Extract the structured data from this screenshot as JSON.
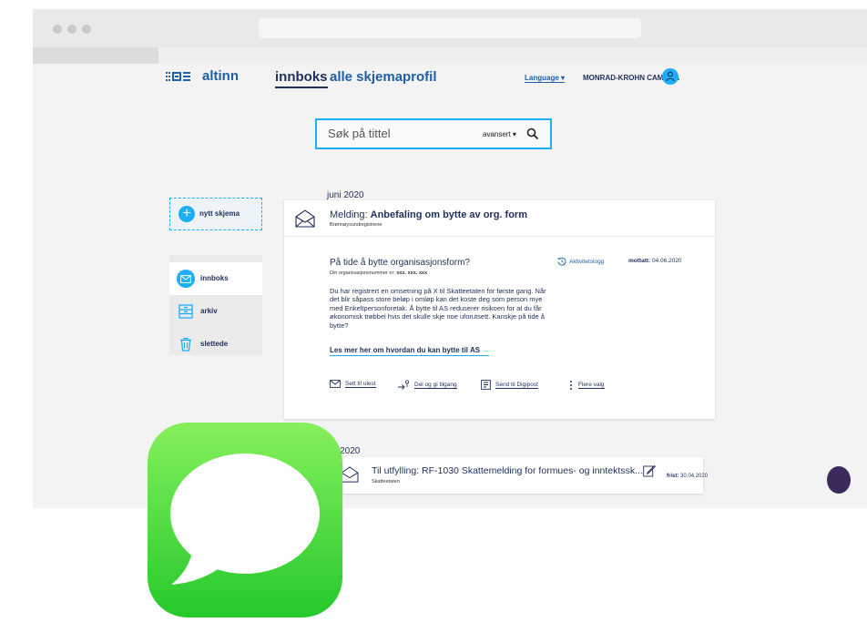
{
  "browser": {
    "url": ""
  },
  "header": {
    "logo_text": "altinn",
    "nav": [
      {
        "label": "innboks",
        "active": true
      },
      {
        "label": "alle skjema",
        "active": false
      },
      {
        "label": "profil",
        "active": false
      }
    ],
    "language_label": "Language ▾",
    "user_name": "MONRAD-KROHN CAMILLA"
  },
  "search": {
    "placeholder": "Søk på tittel",
    "value": "",
    "advanced_label": "avansert ▾"
  },
  "sidebar": {
    "new_form_label": "nytt skjema",
    "items": [
      {
        "label": "innboks",
        "icon": "envelope-icon",
        "active": true
      },
      {
        "label": "arkiv",
        "icon": "archive-icon",
        "active": false
      },
      {
        "label": "slettede",
        "icon": "trash-icon",
        "active": false
      }
    ]
  },
  "sections": [
    {
      "heading": "juni 2020"
    },
    {
      "heading": "rs 2020"
    }
  ],
  "message": {
    "prefix": "Melding:",
    "title": "Anbefaling om bytte av org. form",
    "sender": "Brønnøysundregistrene",
    "body_heading": "På tide å bytte organisasjonsform?",
    "orgnr_label": "Din organisasjonsnummer er:",
    "orgnr_value": "xxx. xxx. xxx",
    "body_text": "Du har registrert en omsetning på X til Skatteetaten for første gang. Når det blir såpass store beløp i omløp kan det koste deg som person mye med Enkeltpersonforetak. Å bytte til AS reduserer risikoen for at du får økonomisk trøbbel hvis det skulle skje noe uforutsett. Kanskje på tide å bytte?",
    "read_more": "Les mer her om hvordan du kan bytte til AS",
    "read_more_arrow": "→",
    "activity_label": "Aktivitetslogg",
    "received_label": "mottatt:",
    "received_date": "04.06.2020",
    "actions": [
      {
        "label": "Sett til ulest",
        "icon": "envelope-icon"
      },
      {
        "label": "Del og gi tilgang",
        "icon": "share-icon"
      },
      {
        "label": "Send til Digipost",
        "icon": "digipost-icon"
      },
      {
        "label": "Flere valg",
        "icon": "more-icon"
      }
    ]
  },
  "message2": {
    "title": "Til utfylling: RF-1030 Skattemelding for formues- og inntektssk...",
    "sender": "Skatteetaten",
    "deadline_label": "frist:",
    "deadline_date": "30.04.2020"
  },
  "colors": {
    "accent": "#1eadf7",
    "brand_blue": "#1e5fa5",
    "navy": "#1e2f5a",
    "messages_green_top": "#86f05c",
    "messages_green_bottom": "#25c92c"
  }
}
